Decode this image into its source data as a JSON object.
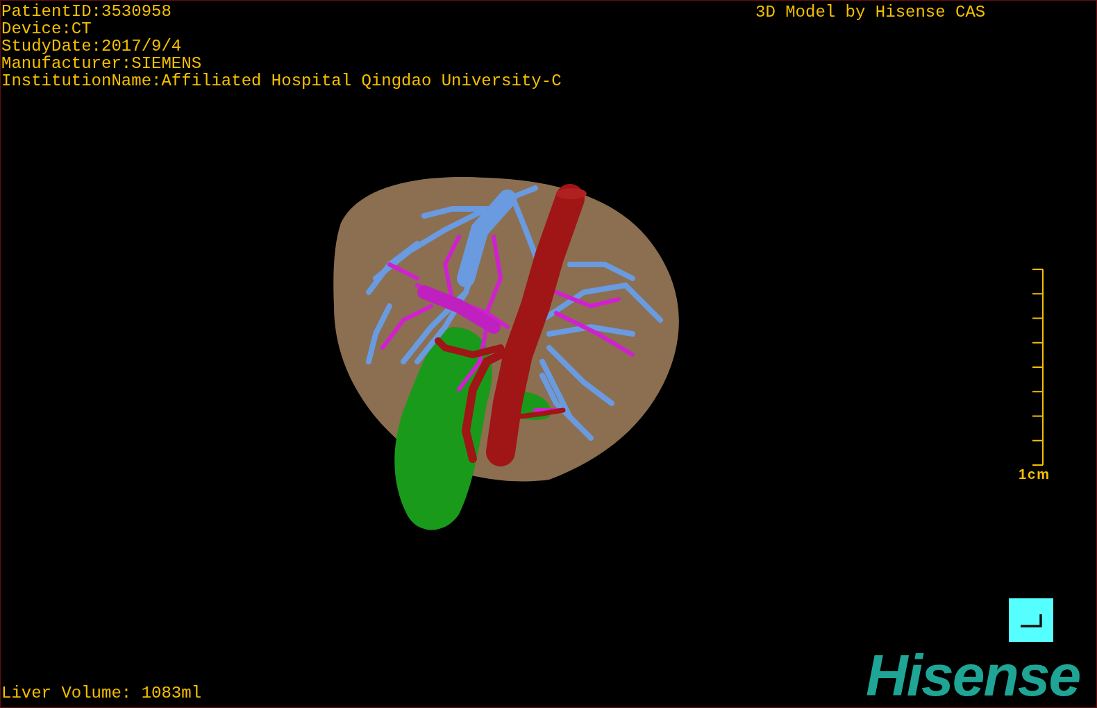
{
  "study_info": [
    "PatientID:3530958",
    "Device:CT",
    "StudyDate:2017/9/4",
    "Manufacturer:SIEMENS",
    "InstitutionName:Affiliated Hospital Qingdao University-C"
  ],
  "caption": "3D Model by Hisense CAS",
  "scale_bar": {
    "label": "1cm"
  },
  "liver_volume": "Liver Volume: 1083ml",
  "logo": "Hisense"
}
